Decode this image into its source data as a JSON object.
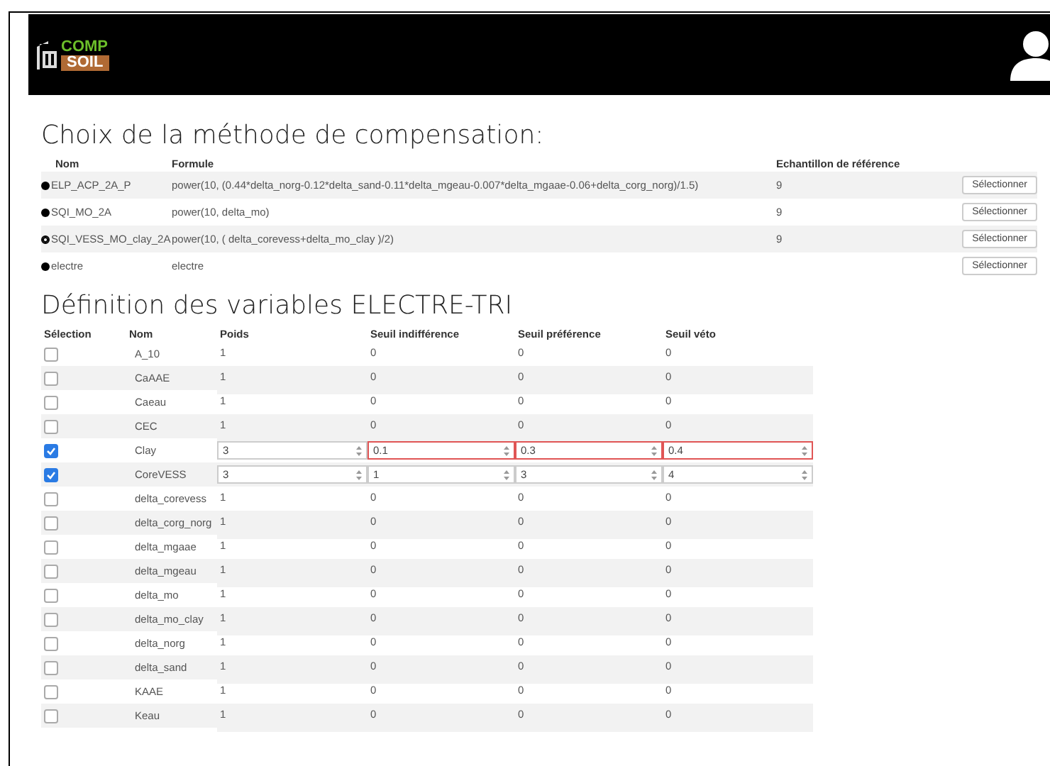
{
  "header": {
    "logo_top": "COMP",
    "logo_bottom": "SOIL"
  },
  "methods": {
    "title": "Choix de la méthode de compensation:",
    "columns": [
      "Nom",
      "Formule",
      "Echantillon de référence"
    ],
    "rows": [
      {
        "name": "ELP_ACP_2A_P",
        "formula": "power(10, (0.44*delta_norg-0.12*delta_sand-0.11*delta_mgeau-0.007*delta_mgaae-0.06+delta_corg_norg)/1.5)",
        "reference": "9",
        "selected": false,
        "button": "Sélectionner"
      },
      {
        "name": "SQI_MO_2A",
        "formula": "power(10, delta_mo)",
        "reference": "9",
        "selected": false,
        "button": "Sélectionner"
      },
      {
        "name": "SQI_VESS_MO_clay_2A",
        "formula": "power(10, ( delta_corevess+delta_mo_clay )/2)",
        "reference": "9",
        "selected": true,
        "button": "Sélectionner"
      },
      {
        "name": "electre",
        "formula": "electre",
        "selected": false,
        "button": "Sélectionner"
      }
    ]
  },
  "variables": {
    "title": "Définition des variables ELECTRE-TRI",
    "columns": [
      "Sélection",
      "Nom",
      "Poids",
      "Seuil indifférence",
      "Seuil préférence",
      "Seuil véto"
    ],
    "rows": [
      {
        "checked": false,
        "invalid": false,
        "name": "A_10",
        "values": [
          "1",
          "0",
          "0",
          "0"
        ]
      },
      {
        "checked": false,
        "invalid": false,
        "name": "CaAAE",
        "values": [
          "1",
          "0",
          "0",
          "0"
        ]
      },
      {
        "checked": false,
        "invalid": false,
        "name": "Caeau",
        "values": [
          "1",
          "0",
          "0",
          "0"
        ]
      },
      {
        "checked": false,
        "invalid": false,
        "name": "CEC",
        "values": [
          "1",
          "0",
          "0",
          "0"
        ]
      },
      {
        "checked": true,
        "invalid": true,
        "name": "Clay",
        "values": [
          "3",
          "0.1",
          "0.3",
          "0.4"
        ]
      },
      {
        "checked": true,
        "invalid": false,
        "name": "CoreVESS",
        "values": [
          "3",
          "1",
          "3",
          "4"
        ]
      },
      {
        "checked": false,
        "invalid": false,
        "name": "delta_corevess",
        "values": [
          "1",
          "0",
          "0",
          "0"
        ]
      },
      {
        "checked": false,
        "invalid": false,
        "name": "delta_corg_norg",
        "values": [
          "1",
          "0",
          "0",
          "0"
        ]
      },
      {
        "checked": false,
        "invalid": false,
        "name": "delta_mgaae",
        "values": [
          "1",
          "0",
          "0",
          "0"
        ]
      },
      {
        "checked": false,
        "invalid": false,
        "name": "delta_mgeau",
        "values": [
          "1",
          "0",
          "0",
          "0"
        ]
      },
      {
        "checked": false,
        "invalid": false,
        "name": "delta_mo",
        "values": [
          "1",
          "0",
          "0",
          "0"
        ]
      },
      {
        "checked": false,
        "invalid": false,
        "name": "delta_mo_clay",
        "values": [
          "1",
          "0",
          "0",
          "0"
        ]
      },
      {
        "checked": false,
        "invalid": false,
        "name": "delta_norg",
        "values": [
          "1",
          "0",
          "0",
          "0"
        ]
      },
      {
        "checked": false,
        "invalid": false,
        "name": "delta_sand",
        "values": [
          "1",
          "0",
          "0",
          "0"
        ]
      },
      {
        "checked": false,
        "invalid": false,
        "name": "KAAE",
        "values": [
          "1",
          "0",
          "0",
          "0"
        ]
      },
      {
        "checked": false,
        "invalid": false,
        "name": "Keau",
        "values": [
          "1",
          "0",
          "0",
          "0"
        ]
      }
    ]
  }
}
